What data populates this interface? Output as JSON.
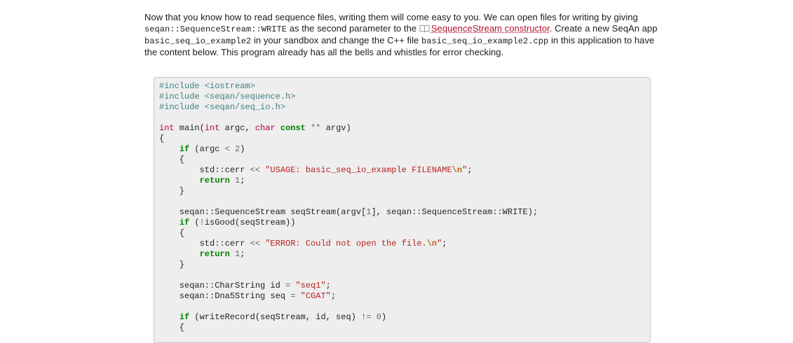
{
  "intro": {
    "t1": "Now that you know how to read sequence files, writing them will come easy to you. We can open files for writing by giving ",
    "c1": "seqan::SequenceStream::WRITE",
    "t2": " as the second parameter to the ",
    "link": "SequenceStream constructor",
    "t3": ". Create a new SeqAn app ",
    "c2": "basic_seq_io_example2",
    "t4": " in your sandbox and change the C++ file ",
    "c3": "basic_seq_io_example2.cpp",
    "t5": " in this application to have the content below. This program already has all the bells and whistles for error checking."
  },
  "icons": {
    "link_icon": "book-icon"
  },
  "code": {
    "l1": [
      "#include <iostream>"
    ],
    "l2": [
      "#include <seqan/sequence.h>"
    ],
    "l3": [
      "#include <seqan/seq_io.h>"
    ],
    "l5": [
      "int",
      " main(",
      "int",
      " argc, ",
      "char",
      " ",
      "const",
      " ",
      "**",
      " argv)"
    ],
    "l6": [
      "{"
    ],
    "l7": [
      "    ",
      "if",
      " (argc ",
      "<",
      " ",
      "2",
      ")"
    ],
    "l8": [
      "    {"
    ],
    "l9": [
      "        std::cerr ",
      "<<",
      " ",
      "\"USAGE: basic_seq_io_example FILENAME",
      "\\n",
      "\"",
      ";"
    ],
    "l10": [
      "        ",
      "return",
      " ",
      "1",
      ";"
    ],
    "l11": [
      "    }"
    ],
    "l13": [
      "    seqan::SequenceStream seqStream(argv[",
      "1",
      "], seqan::SequenceStream::WRITE);"
    ],
    "l14": [
      "    ",
      "if",
      " (",
      "!",
      "isGood(seqStream))"
    ],
    "l15": [
      "    {"
    ],
    "l16": [
      "        std::cerr ",
      "<<",
      " ",
      "\"ERROR: Could not open the file.",
      "\\n",
      "\"",
      ";"
    ],
    "l17": [
      "        ",
      "return",
      " ",
      "1",
      ";"
    ],
    "l18": [
      "    }"
    ],
    "l20": [
      "    seqan::CharString id ",
      "=",
      " ",
      "\"seq1\"",
      ";"
    ],
    "l21": [
      "    seqan::Dna5String seq ",
      "=",
      " ",
      "\"CGAT\"",
      ";"
    ],
    "l23": [
      "    ",
      "if",
      " (writeRecord(seqStream, id, seq) ",
      "!=",
      " ",
      "0",
      ")"
    ],
    "l24": [
      "    {"
    ]
  }
}
